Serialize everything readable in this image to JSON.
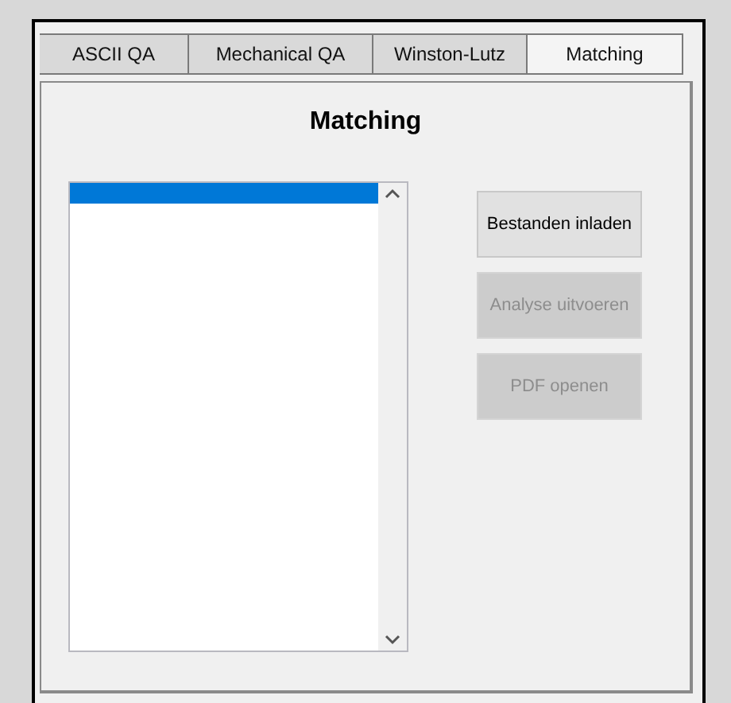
{
  "tabs": [
    {
      "label": "ASCII QA",
      "selected": false
    },
    {
      "label": "Mechanical QA",
      "selected": false
    },
    {
      "label": "Winston-Lutz",
      "selected": false
    },
    {
      "label": "Matching",
      "selected": true
    }
  ],
  "panel": {
    "title": "Matching",
    "file_list": {
      "items": [
        {
          "selected": true
        }
      ]
    },
    "buttons": [
      {
        "label": "Bestanden inladen",
        "disabled": false
      },
      {
        "label": "Analyse uitvoeren",
        "disabled": true
      },
      {
        "label": "PDF openen",
        "disabled": true
      }
    ]
  }
}
